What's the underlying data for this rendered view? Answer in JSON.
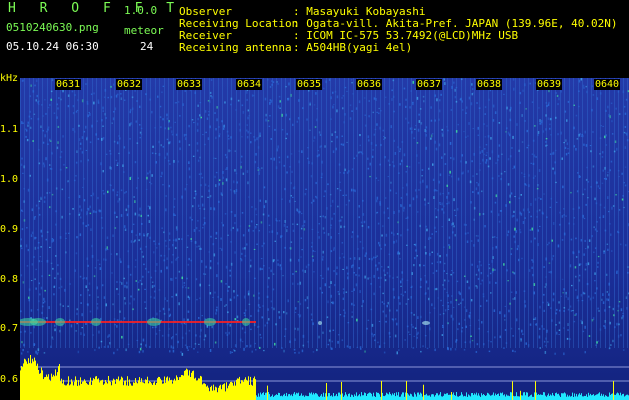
{
  "header": {
    "app_name": "H R O F F T",
    "version": "1.0.0",
    "filename": "0510240630.png",
    "meteor_label": "meteor",
    "datetime": "05.10.24 06:30",
    "meteor_count": "24"
  },
  "station": {
    "observer_label": "Observer",
    "observer_value": ": Masayuki Kobayashi",
    "location_label": "Receiving Location",
    "location_value": ": Ogata-vill. Akita-Pref. JAPAN (139.96E, 40.02N)",
    "receiver_label": "Receiver",
    "receiver_value": ": ICOM IC-575 53.7492(@LCD)MHz USB",
    "antenna_label": "Receiving antenna",
    "antenna_value": ": A504HB(yagi 4el)"
  },
  "spectrogram": {
    "unit_label": "kHz",
    "y_ticks": [
      "1.1",
      "1.0",
      "0.9",
      "0.8",
      "0.7",
      "0.6"
    ],
    "time_ticks": [
      "0631",
      "0632",
      "0633",
      "0634",
      "0635",
      "0636",
      "0637",
      "0638",
      "0639",
      "0640"
    ],
    "colors": {
      "background": "#1a2a9a",
      "noise": "#2a6ad8",
      "signal_hot": "#ff2020",
      "signal_warm": "#40e0a0",
      "power_yellow": "#ffff00",
      "power_cyan": "#20e8ff"
    }
  }
}
